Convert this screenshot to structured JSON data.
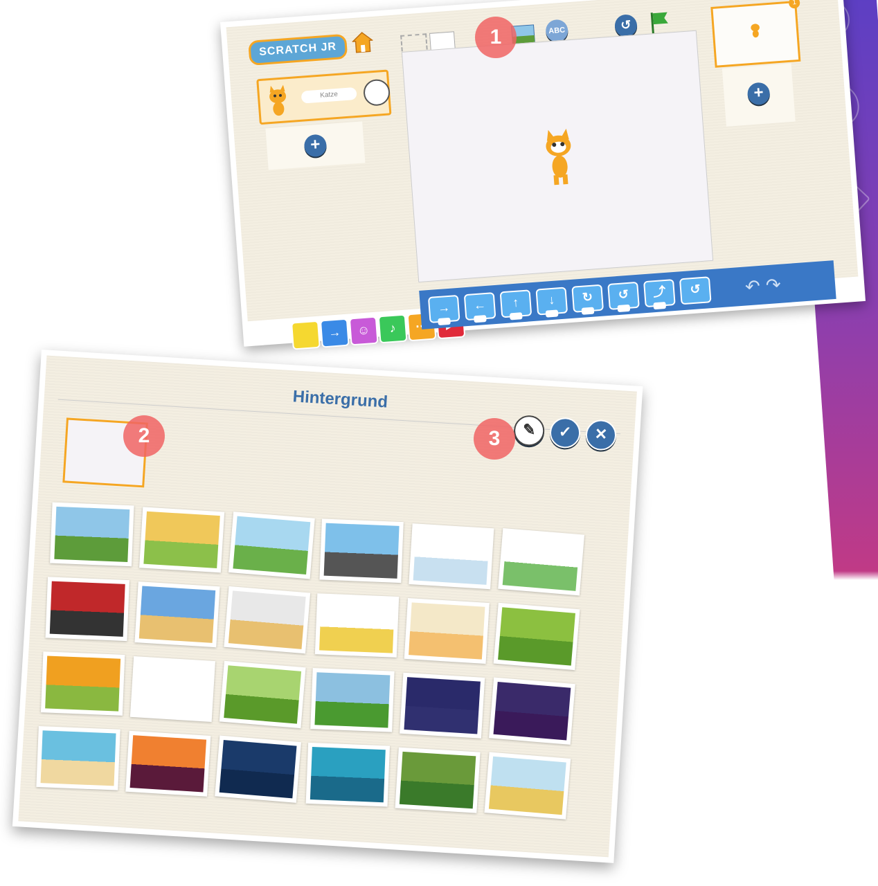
{
  "editor": {
    "logo": "SCRATCH JR",
    "sprite_name": "Katze",
    "page_number": "1"
  },
  "background_dialog": {
    "title": "Hintergrund",
    "tiles": [
      {
        "sky": "#8fc6e8",
        "ground": "#5d9c3a"
      },
      {
        "sky": "#f0c85a",
        "ground": "#8cc04a"
      },
      {
        "sky": "#a8d8f0",
        "ground": "#6ab04a"
      },
      {
        "sky": "#7ec0ea",
        "ground": "#555"
      },
      {
        "sky": "#ffffff",
        "ground": "#c8e0f0"
      },
      {
        "sky": "#ffffff",
        "ground": "#7ac06a"
      },
      {
        "sky": "#c0282a",
        "ground": "#333"
      },
      {
        "sky": "#6aa6e0",
        "ground": "#e8c070"
      },
      {
        "sky": "#e8e8e8",
        "ground": "#e8c070"
      },
      {
        "sky": "#ffffff",
        "ground": "#f0d050"
      },
      {
        "sky": "#f4e8c8",
        "ground": "#f4c070"
      },
      {
        "sky": "#8cc040",
        "ground": "#5a9a2a"
      },
      {
        "sky": "#f0a020",
        "ground": "#8ab840"
      },
      {
        "sky": "#ffffff",
        "ground": "#ffffff"
      },
      {
        "sky": "#a8d470",
        "ground": "#5a9a2a"
      },
      {
        "sky": "#8cc0e0",
        "ground": "#4a9a30"
      },
      {
        "sky": "#2a2a6a",
        "ground": "#303070"
      },
      {
        "sky": "#3a2a6a",
        "ground": "#3a1a5a"
      },
      {
        "sky": "#6ac0e0",
        "ground": "#f0d8a0"
      },
      {
        "sky": "#f08030",
        "ground": "#5a1a3a"
      },
      {
        "sky": "#1a3a6a",
        "ground": "#102a50"
      },
      {
        "sky": "#2aa0c0",
        "ground": "#1a6a8a"
      },
      {
        "sky": "#6a9a3a",
        "ground": "#3a7a2a"
      },
      {
        "sky": "#bfe0f0",
        "ground": "#e8c860"
      }
    ]
  },
  "markers": [
    "1",
    "2",
    "3"
  ]
}
